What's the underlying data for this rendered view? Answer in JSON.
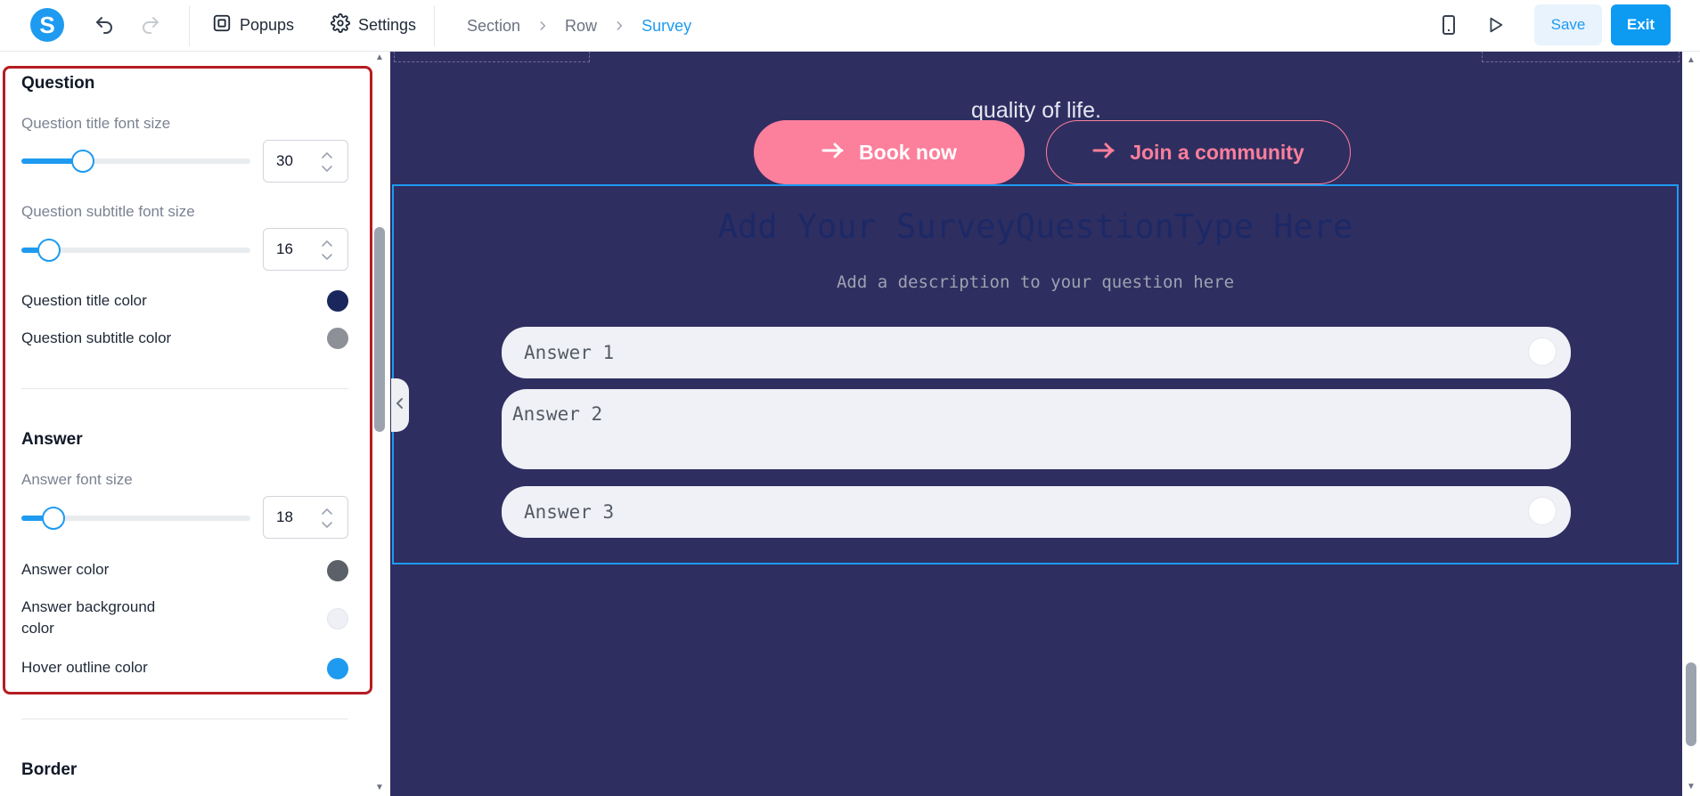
{
  "topbar": {
    "logo_letter": "S",
    "popups_label": "Popups",
    "settings_label": "Settings",
    "breadcrumb": [
      "Section",
      "Row",
      "Survey"
    ],
    "save_label": "Save",
    "exit_label": "Exit"
  },
  "panel": {
    "question": {
      "title": "Question",
      "title_font_size_label": "Question title font size",
      "title_font_size": "30",
      "title_font_size_fraction": 0.27,
      "subtitle_font_size_label": "Question subtitle font size",
      "subtitle_font_size": "16",
      "subtitle_font_size_fraction": 0.12,
      "title_color_label": "Question title color",
      "title_color": "#19275d",
      "subtitle_color_label": "Question subtitle color",
      "subtitle_color": "#8e9098"
    },
    "answer": {
      "title": "Answer",
      "font_size_label": "Answer font size",
      "font_size": "18",
      "font_size_fraction": 0.14,
      "color_label": "Answer color",
      "color": "#5b6069",
      "background_label_line1": "Answer background",
      "background_label_line2": "color",
      "background_color": "#eef0f6",
      "hover_label": "Hover outline color",
      "hover_color": "#1e9bf0"
    },
    "border_title": "Border"
  },
  "canvas": {
    "quality_text": "quality of life.",
    "book_label": "Book now",
    "join_label": "Join a community",
    "survey_title": "Add Your SurveyQuestionType Here",
    "survey_description": "Add a description to your question here",
    "answers": [
      "Answer 1",
      "Answer 2",
      "Answer 3"
    ]
  },
  "colors": {
    "accent": "#1e9bf0",
    "canvas_bg": "#2f2e61",
    "cta_pink": "#fc7f9b",
    "highlight_red": "#b51c23"
  }
}
